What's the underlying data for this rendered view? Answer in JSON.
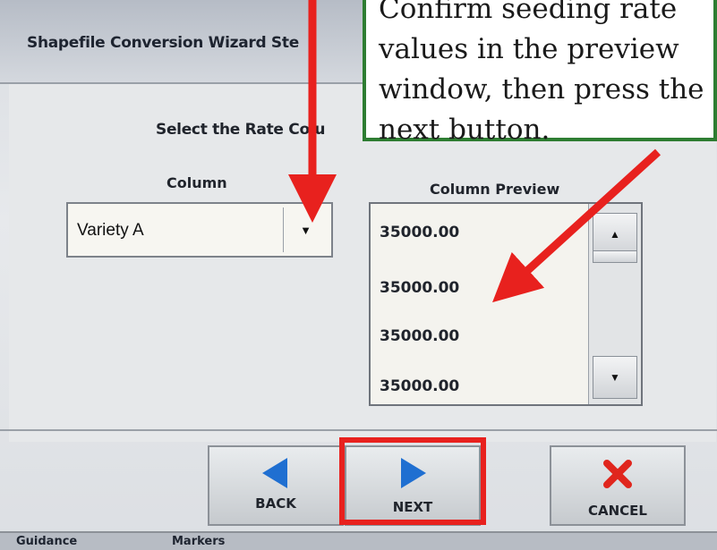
{
  "window": {
    "title": "Shapefile Conversion Wizard    Ste"
  },
  "wizard": {
    "prompt": "Select the Rate Colu",
    "column_label": "Column",
    "column_preview_label": "Column Preview",
    "column_dropdown": {
      "value": "Variety A",
      "icon": "chevron-down-icon"
    },
    "preview_rows": [
      "35000.00",
      "35000.00",
      "35000.00",
      "35000.00"
    ],
    "scroll_up_icon": "arrow-up-icon",
    "scroll_down_icon": "arrow-down-icon"
  },
  "buttons": {
    "back": {
      "label": "BACK",
      "icon": "left-triangle-icon",
      "color": "#1f6fd1"
    },
    "next": {
      "label": "NEXT",
      "icon": "right-triangle-icon",
      "color": "#1f6fd1"
    },
    "cancel": {
      "label": "CANCEL",
      "icon": "x-icon",
      "color": "#e0261d"
    }
  },
  "bottom_tabs": [
    "Guidance",
    "Markers"
  ],
  "callout": {
    "lines": [
      "Confirm seeding rate",
      "values in the preview",
      "window, then press the",
      "next button."
    ],
    "border_color": "#2e7d32"
  },
  "annotations": {
    "arrow_color": "#e8211e",
    "highlight_color": "#e8211e"
  }
}
